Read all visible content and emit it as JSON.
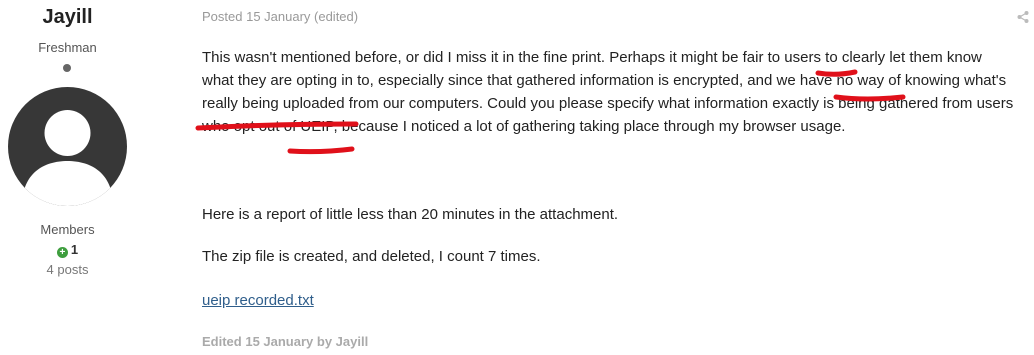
{
  "author": {
    "name": "Jayill",
    "title": "Freshman",
    "group": "Members",
    "reputation": "1",
    "posts": "4 posts"
  },
  "post": {
    "meta": "Posted 15 January (edited)",
    "paragraphs": [
      "This wasn't mentioned before, or did I miss it in the fine print. Perhaps it might be fair to users to clearly let them know what they are opting in to, especially since that gathered information is encrypted, and we have no way of knowing what's really being uploaded from our computers. Could you please specify what information exactly is being gathered from users who opt out of UEIP, because I noticed a lot of gathering taking place through my browser usage.",
      "Here is a report of little less than 20 minutes in the attachment.",
      "The zip file is created, and deleted, I count 7 times."
    ],
    "attachment": "ueip recorded.txt",
    "edited": "Edited 15 January by Jayill"
  },
  "colors": {
    "annotation": "#e0101a",
    "link": "#2f5e8b",
    "reputation_positive": "#3e9e3e"
  },
  "icons": {
    "share": "share-icon",
    "reputation": "plus-circle-icon"
  }
}
